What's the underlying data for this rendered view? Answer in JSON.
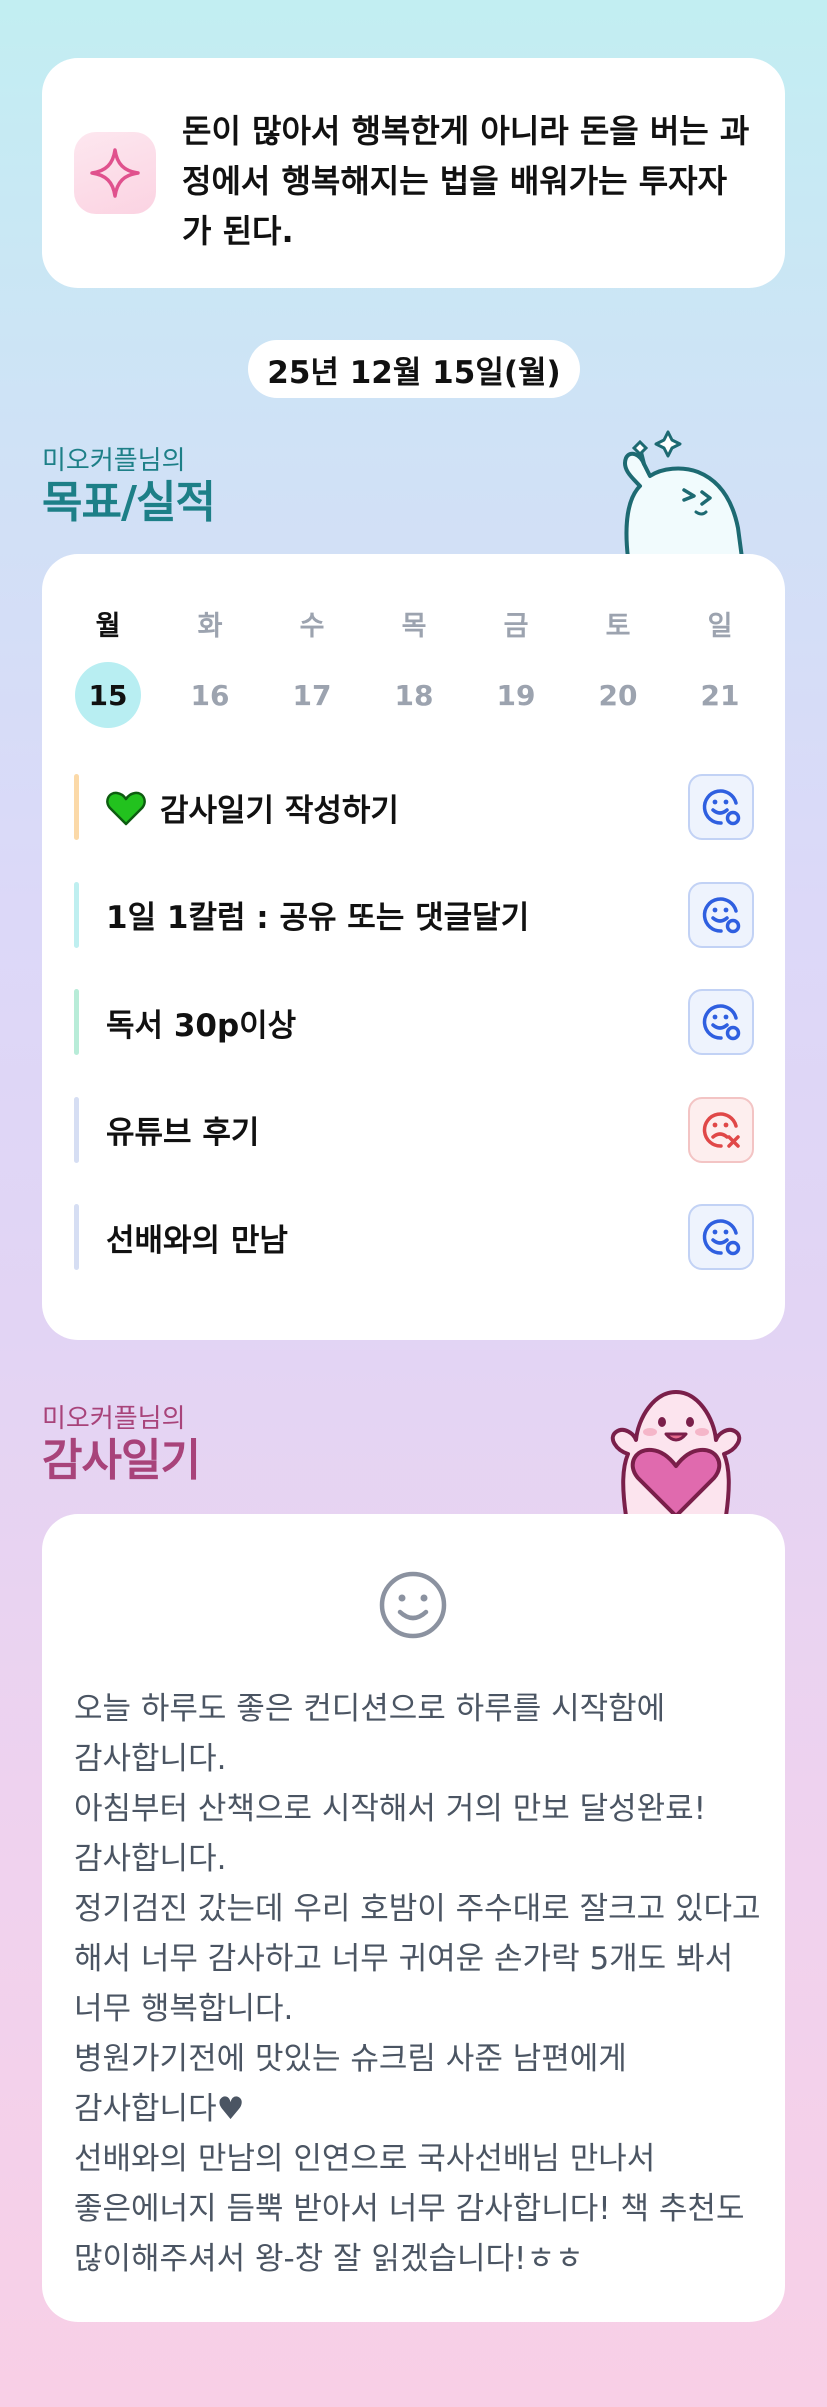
{
  "quote": {
    "icon": "sparkle-icon",
    "text": "돈이 많아서 행복한게 아니라 돈을 버는 과정에서 행복해지는 법을 배워가는 투자자가 된다."
  },
  "date_label": "25년 12월 15일(월)",
  "goals_section": {
    "subtitle": "미오커플님의",
    "title": "목표/실적"
  },
  "week": {
    "days": [
      {
        "name": "월",
        "num": "15",
        "active": true
      },
      {
        "name": "화",
        "num": "16"
      },
      {
        "name": "수",
        "num": "17"
      },
      {
        "name": "목",
        "num": "18"
      },
      {
        "name": "금",
        "num": "19"
      },
      {
        "name": "토",
        "num": "20"
      },
      {
        "name": "일",
        "num": "21"
      }
    ]
  },
  "goals": [
    {
      "label": "감사일기 작성하기",
      "icon": "green-heart-icon",
      "bar_color": "#fbd9a8",
      "status": "done"
    },
    {
      "label": "1일 1칼럼 : 공유 또는 댓글달기",
      "bar_color": "#bfeff0",
      "status": "done"
    },
    {
      "label": "독서 30p이상",
      "bar_color": "#b8ecd8",
      "status": "done"
    },
    {
      "label": "유튜브 후기",
      "bar_color": "#d6def3",
      "status": "failed"
    },
    {
      "label": "선배와의 만남",
      "bar_color": "#d6def3",
      "status": "done"
    }
  ],
  "gratitude_section": {
    "subtitle": "미오커플님의",
    "title": "감사일기"
  },
  "gratitude": {
    "mood_icon": "smile-face-icon",
    "text": "오늘 하루도 좋은 컨디션으로 하루를 시작함에 감사합니다.\n아침부터 산책으로 시작해서 거의 만보 달성완료! 감사합니다.\n정기검진 갔는데 우리 호밤이 주수대로 잘크고 있다고 해서 너무 감사하고 너무 귀여운 손가락 5개도 봐서 너무 행복합니다.\n병원가기전에 맛있는 슈크림 사준 남편에게 감사합니다♥\n선배와의 만남의 인연으로 국사선배님 만나서 좋은에너지 듬뿍 받아서 너무 감사합니다! 책 추천도 많이해주셔서 왕-창 잘 읽겠습니다!ㅎㅎ"
  },
  "colors": {
    "accent_teal": "#1d7f87",
    "accent_plum": "#a8437a",
    "ok_blue": "#2f5fe0",
    "fail_red": "#e04848"
  }
}
